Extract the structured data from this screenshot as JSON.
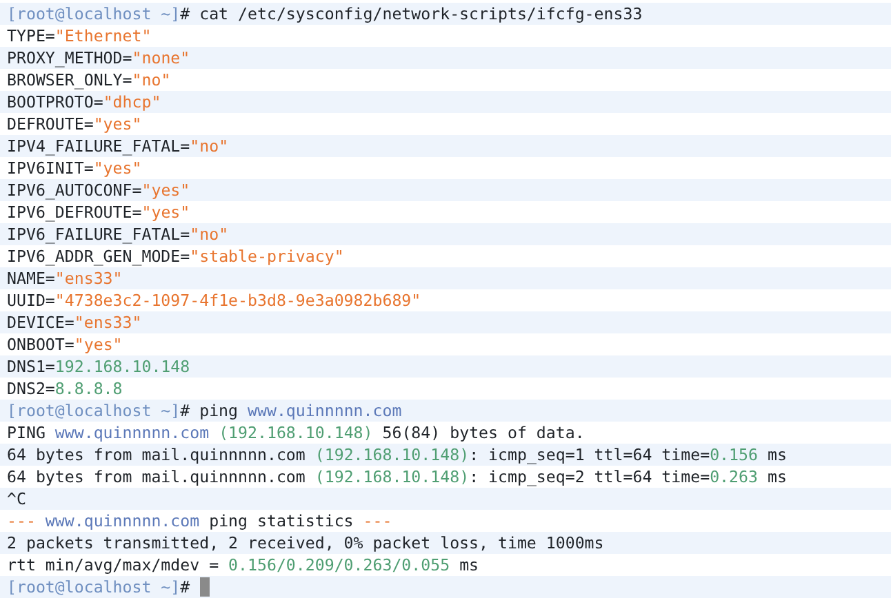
{
  "terminal": {
    "cursor_visible": true,
    "lines": [
      {
        "segments": [
          {
            "kind": "prompt",
            "text": "[root@localhost ~]"
          },
          {
            "kind": "plain",
            "text": "# cat /etc/sysconfig/network-scripts/ifcfg-ens33"
          }
        ]
      },
      {
        "segments": [
          {
            "kind": "plain",
            "text": "TYPE="
          },
          {
            "kind": "string",
            "text": "\"Ethernet\""
          }
        ]
      },
      {
        "segments": [
          {
            "kind": "plain",
            "text": "PROXY_METHOD="
          },
          {
            "kind": "string",
            "text": "\"none\""
          }
        ]
      },
      {
        "segments": [
          {
            "kind": "plain",
            "text": "BROWSER_ONLY="
          },
          {
            "kind": "string",
            "text": "\"no\""
          }
        ]
      },
      {
        "segments": [
          {
            "kind": "plain",
            "text": "BOOTPROTO="
          },
          {
            "kind": "string",
            "text": "\"dhcp\""
          }
        ]
      },
      {
        "segments": [
          {
            "kind": "plain",
            "text": "DEFROUTE="
          },
          {
            "kind": "string",
            "text": "\"yes\""
          }
        ]
      },
      {
        "segments": [
          {
            "kind": "plain",
            "text": "IPV4_FAILURE_FATAL="
          },
          {
            "kind": "string",
            "text": "\"no\""
          }
        ]
      },
      {
        "segments": [
          {
            "kind": "plain",
            "text": "IPV6INIT="
          },
          {
            "kind": "string",
            "text": "\"yes\""
          }
        ]
      },
      {
        "segments": [
          {
            "kind": "plain",
            "text": "IPV6_AUTOCONF="
          },
          {
            "kind": "string",
            "text": "\"yes\""
          }
        ]
      },
      {
        "segments": [
          {
            "kind": "plain",
            "text": "IPV6_DEFROUTE="
          },
          {
            "kind": "string",
            "text": "\"yes\""
          }
        ]
      },
      {
        "segments": [
          {
            "kind": "plain",
            "text": "IPV6_FAILURE_FATAL="
          },
          {
            "kind": "string",
            "text": "\"no\""
          }
        ]
      },
      {
        "segments": [
          {
            "kind": "plain",
            "text": "IPV6_ADDR_GEN_MODE="
          },
          {
            "kind": "string",
            "text": "\"stable-privacy\""
          }
        ]
      },
      {
        "segments": [
          {
            "kind": "plain",
            "text": "NAME="
          },
          {
            "kind": "string",
            "text": "\"ens33\""
          }
        ]
      },
      {
        "segments": [
          {
            "kind": "plain",
            "text": "UUID="
          },
          {
            "kind": "string",
            "text": "\"4738e3c2-1097-4f1e-b3d8-9e3a0982b689\""
          }
        ]
      },
      {
        "segments": [
          {
            "kind": "plain",
            "text": "DEVICE="
          },
          {
            "kind": "string",
            "text": "\"ens33\""
          }
        ]
      },
      {
        "segments": [
          {
            "kind": "plain",
            "text": "ONBOOT="
          },
          {
            "kind": "string",
            "text": "\"yes\""
          }
        ]
      },
      {
        "segments": [
          {
            "kind": "plain",
            "text": "DNS1="
          },
          {
            "kind": "number",
            "text": "192.168.10.148"
          }
        ]
      },
      {
        "segments": [
          {
            "kind": "plain",
            "text": "DNS2="
          },
          {
            "kind": "number",
            "text": "8.8.8.8"
          }
        ]
      },
      {
        "segments": [
          {
            "kind": "prompt",
            "text": "[root@localhost ~]"
          },
          {
            "kind": "plain",
            "text": "# ping "
          },
          {
            "kind": "url",
            "text": "www.quinnnnn.com"
          }
        ]
      },
      {
        "segments": [
          {
            "kind": "plain",
            "text": "PING "
          },
          {
            "kind": "url",
            "text": "www.quinnnnn.com"
          },
          {
            "kind": "number",
            "text": " (192.168.10.148)"
          },
          {
            "kind": "plain",
            "text": " 56(84) bytes of data."
          }
        ]
      },
      {
        "segments": [
          {
            "kind": "plain",
            "text": "64 bytes from mail.quinnnnn.com "
          },
          {
            "kind": "number",
            "text": "(192.168.10.148)"
          },
          {
            "kind": "plain",
            "text": ": icmp_seq=1 ttl=64 time="
          },
          {
            "kind": "number",
            "text": "0.156"
          },
          {
            "kind": "plain",
            "text": " ms"
          }
        ]
      },
      {
        "segments": [
          {
            "kind": "plain",
            "text": "64 bytes from mail.quinnnnn.com "
          },
          {
            "kind": "number",
            "text": "(192.168.10.148)"
          },
          {
            "kind": "plain",
            "text": ": icmp_seq=2 ttl=64 time="
          },
          {
            "kind": "number",
            "text": "0.263"
          },
          {
            "kind": "plain",
            "text": " ms"
          }
        ]
      },
      {
        "segments": [
          {
            "kind": "plain",
            "text": "^C"
          }
        ]
      },
      {
        "segments": [
          {
            "kind": "string",
            "text": "--- "
          },
          {
            "kind": "url",
            "text": "www.quinnnnn.com"
          },
          {
            "kind": "plain",
            "text": " ping statistics "
          },
          {
            "kind": "string",
            "text": "---"
          }
        ]
      },
      {
        "segments": [
          {
            "kind": "plain",
            "text": "2 packets transmitted, 2 received, 0% packet loss, time 1000ms"
          }
        ]
      },
      {
        "segments": [
          {
            "kind": "plain",
            "text": "rtt min/avg/max/mdev = "
          },
          {
            "kind": "number",
            "text": "0.156/0.209/0.263/0.055"
          },
          {
            "kind": "plain",
            "text": " ms"
          }
        ]
      },
      {
        "segments": [
          {
            "kind": "prompt",
            "text": "[root@localhost ~]"
          },
          {
            "kind": "plain",
            "text": "#"
          }
        ]
      }
    ]
  }
}
